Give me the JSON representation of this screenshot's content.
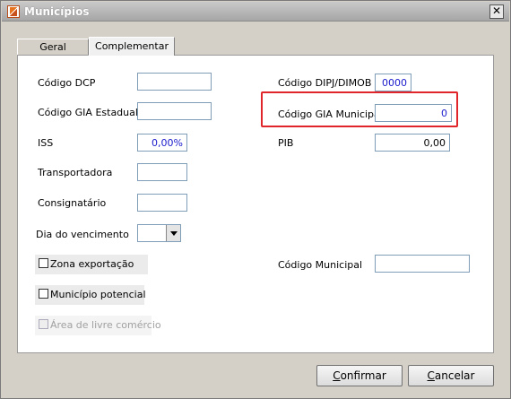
{
  "window": {
    "title": "Municípios"
  },
  "tabs": [
    {
      "label": "Geral"
    },
    {
      "label": "Complementar"
    }
  ],
  "form": {
    "codigo_dcp": {
      "label": "Código DCP",
      "value": ""
    },
    "codigo_gia_estadual": {
      "label": "Código GIA Estadual",
      "value": ""
    },
    "iss": {
      "label": "ISS",
      "value": "0,00%"
    },
    "transportadora": {
      "label": "Transportadora",
      "value": ""
    },
    "consignatario": {
      "label": "Consignatário",
      "value": ""
    },
    "dia_vencimento": {
      "label": "Dia do vencimento",
      "value": ""
    },
    "codigo_dipj_dimob": {
      "label": "Código DIPJ/DIMOB",
      "value": "0000"
    },
    "codigo_gia_municipal": {
      "label": "Código GIA Municipal",
      "value": "0"
    },
    "pib": {
      "label": "PIB",
      "value": "0,00"
    },
    "codigo_municipal": {
      "label": "Código Municipal",
      "value": ""
    },
    "zona_exportacao": {
      "label": "Zona exportação",
      "checked": false
    },
    "municipio_potencial": {
      "label": "Município potencial",
      "checked": false
    },
    "area_livre_comercio": {
      "label": "Área de livre comércio",
      "checked": false,
      "disabled": true
    }
  },
  "buttons": {
    "confirm": "Confirmar",
    "cancel": "Cancelar"
  },
  "colors": {
    "highlight": "#e0262a",
    "field_text": "#1a1acc"
  }
}
